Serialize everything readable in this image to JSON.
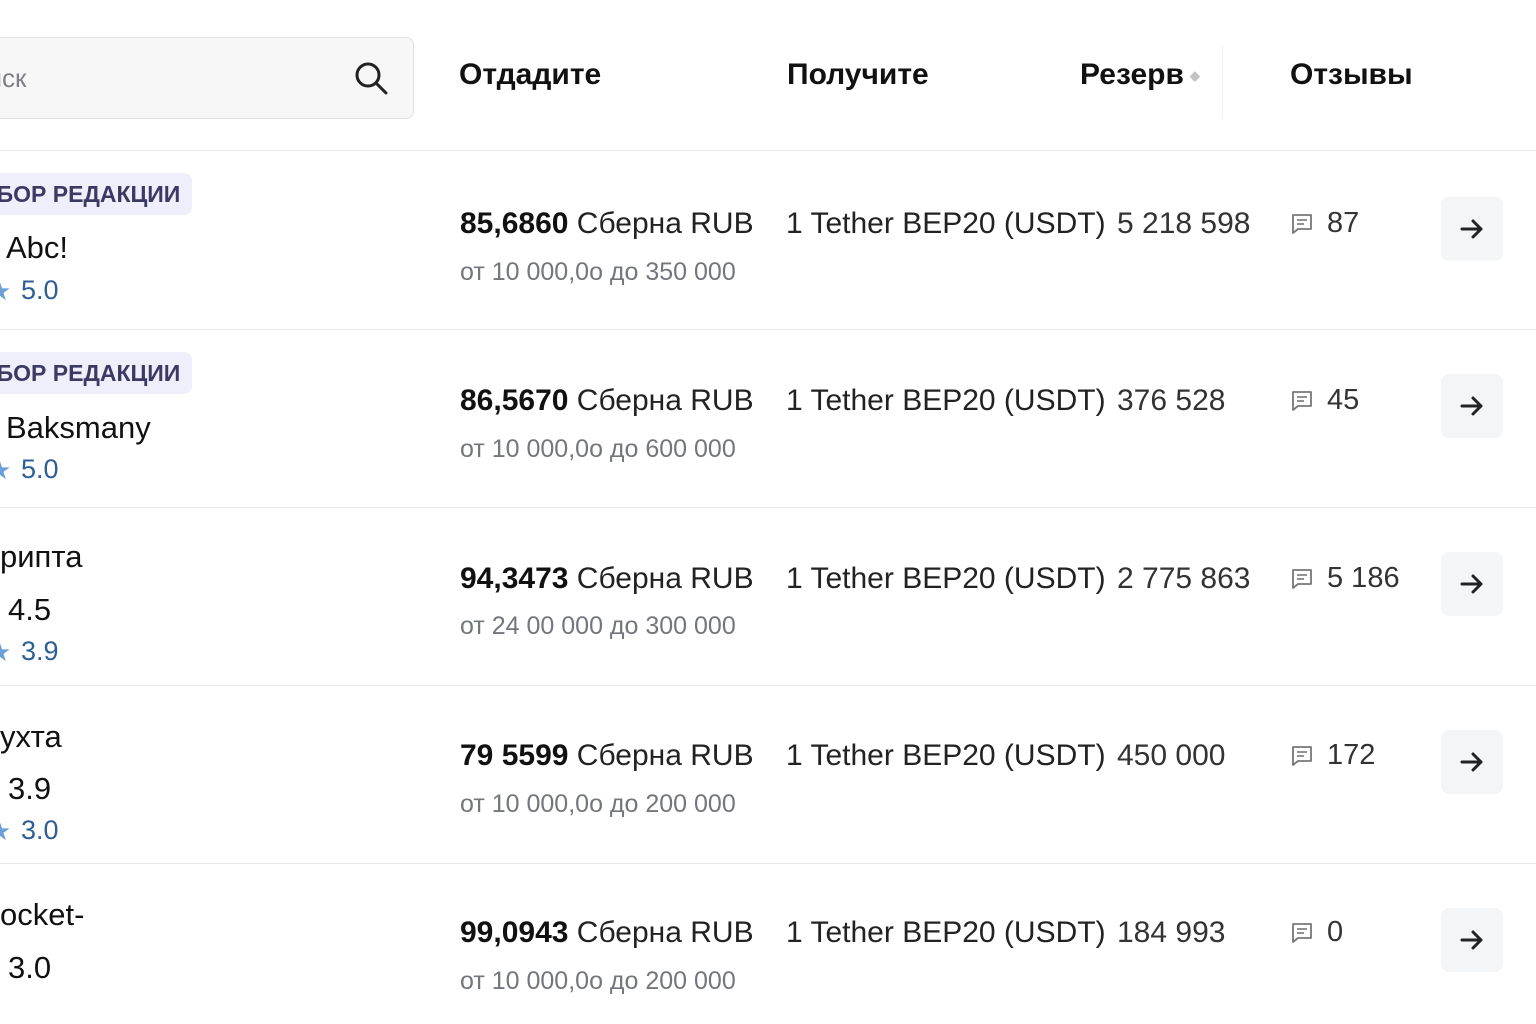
{
  "search": {
    "placeholder": "оиск"
  },
  "columns": {
    "give": "Отдадите",
    "receive": "Получите",
    "reserve": "Резерв",
    "reviews": "Отзывы"
  },
  "rows": [
    {
      "badge": "НБОР РЕДАКЦИИ",
      "name": "Abc!",
      "secondary_rating": "",
      "rating": "5.0",
      "rate_value": "85,6860",
      "rate_currency": "Сберна RUB",
      "limits": "от 10 000,0о до 350 000",
      "receive": "1 Tether BEP20 (USDT)",
      "reserve": "5 218 598",
      "reviews": "87"
    },
    {
      "badge": "НБОР РЕДАКЦИИ",
      "name": "Baksmany",
      "secondary_rating": "",
      "rating": "5.0",
      "rate_value": "86,5670",
      "rate_currency": "Сберна RUB",
      "limits": "от 10 000,0о до 600 000",
      "receive": "1 Tether BEP20 (USDT)",
      "reserve": "376 528",
      "reviews": "45"
    },
    {
      "badge": "",
      "name": "рипта",
      "secondary_rating": "4.5",
      "rating": "3.9",
      "rate_value": "94,3473",
      "rate_currency": "Сберна RUB",
      "limits": "от 24 00 000 до 300 000",
      "receive": "1 Tether BEP20 (USDT)",
      "reserve": "2 775 863",
      "reviews": "5 186"
    },
    {
      "badge": "",
      "name": "ухта",
      "secondary_rating": "3.9",
      "rating": "3.0",
      "rate_value": "79 5599",
      "rate_currency": "Сберна RUB",
      "limits": "от 10 000,0о до 200 000",
      "receive": "1 Tether BEP20 (USDT)",
      "reserve": "450 000",
      "reviews": "172"
    },
    {
      "badge": "",
      "name": "ocket-",
      "secondary_rating": "3.0",
      "rating": "",
      "rate_value": "99,0943",
      "rate_currency": "Сберна RUB",
      "limits": "от 10 000,0о до 200 000",
      "receive": "1 Tether BEP20 (USDT)",
      "reserve": "184 993",
      "reviews": "0"
    }
  ],
  "icons": {
    "search": "search-icon",
    "sort": "sort-icon",
    "reviews": "comment-icon",
    "open": "arrow-right-icon",
    "rating": "star-icon"
  },
  "colors": {
    "badge_bg": "#efeefb",
    "badge_text": "#3b3a63",
    "rating_text": "#2c5f94",
    "button_bg": "#f4f5f7"
  }
}
